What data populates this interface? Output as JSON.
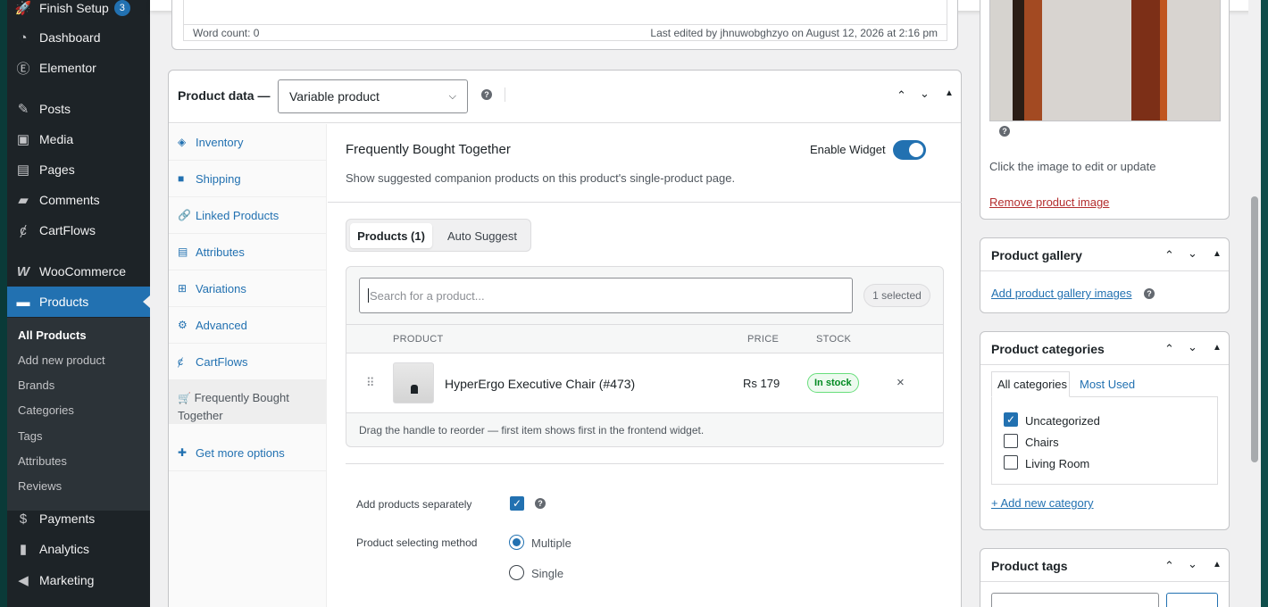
{
  "admin_menu": {
    "items": [
      {
        "label": "Finish Setup",
        "icon": "rocket-icon",
        "badge": "3"
      },
      {
        "label": "Dashboard",
        "icon": "dashboard-icon"
      },
      {
        "label": "Elementor",
        "icon": "elementor-icon"
      },
      {
        "label": "Posts",
        "icon": "pin-icon"
      },
      {
        "label": "Media",
        "icon": "media-icon"
      },
      {
        "label": "Pages",
        "icon": "pages-icon"
      },
      {
        "label": "Comments",
        "icon": "comment-icon"
      },
      {
        "label": "CartFlows",
        "icon": "cartflows-icon"
      },
      {
        "label": "WooCommerce",
        "icon": "woo-icon"
      },
      {
        "label": "Products",
        "icon": "archive-icon",
        "current": true
      },
      {
        "label": "Payments",
        "icon": "dollar-icon"
      },
      {
        "label": "Analytics",
        "icon": "chart-icon"
      },
      {
        "label": "Marketing",
        "icon": "megaphone-icon"
      }
    ],
    "submenu": [
      "All Products",
      "Add new product",
      "Brands",
      "Categories",
      "Tags",
      "Attributes",
      "Reviews"
    ]
  },
  "editor": {
    "word_count": "Word count: 0",
    "last_edited": "Last edited by jhnuwobghzyo on August 12, 2026 at 2:16 pm"
  },
  "product_data": {
    "title": "Product data —",
    "type_value": "Variable product",
    "tabs": [
      "Inventory",
      "Shipping",
      "Linked Products",
      "Attributes",
      "Variations",
      "Advanced",
      "CartFlows",
      "Frequently Bought Together",
      "Get more options"
    ],
    "active_tab": "Frequently Bought Together"
  },
  "fbt": {
    "heading": "Frequently Bought Together",
    "description": "Show suggested companion products on this product's single-product page.",
    "enable_label": "Enable Widget",
    "enabled": true,
    "tab_products": "Products (1)",
    "tab_auto": "Auto Suggest",
    "search_placeholder": "Search for a product...",
    "selected_count": "1 selected",
    "columns": {
      "product": "PRODUCT",
      "price": "PRICE",
      "stock": "STOCK"
    },
    "rows": [
      {
        "name": "HyperErgo Executive Chair (#473)",
        "price": "Rs 179",
        "stock": "In stock"
      }
    ],
    "footer_note": "Drag the handle to reorder — first item shows first in the frontend widget.",
    "add_separately_label": "Add products separately",
    "add_separately": true,
    "selecting_method_label": "Product selecting method",
    "method_options": [
      "Multiple",
      "Single"
    ],
    "method_selected": "Multiple"
  },
  "sidebar": {
    "image_hint": "Click the image to edit or update",
    "remove_image": "Remove product image",
    "gallery_title": "Product gallery",
    "gallery_link": "Add product gallery images",
    "categories_title": "Product categories",
    "cat_tabs": [
      "All categories",
      "Most Used"
    ],
    "categories": [
      {
        "name": "Uncategorized",
        "checked": true
      },
      {
        "name": "Chairs",
        "checked": false
      },
      {
        "name": "Living Room",
        "checked": false
      }
    ],
    "add_category": "+ Add new category",
    "tags_title": "Product tags"
  }
}
